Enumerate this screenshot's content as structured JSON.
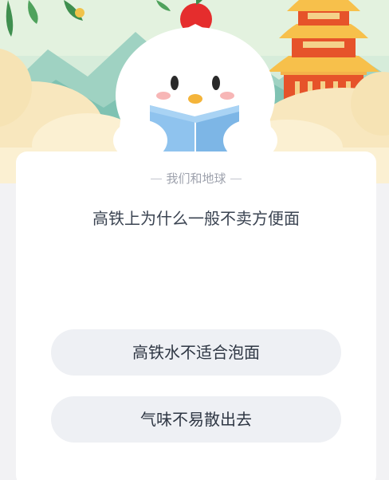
{
  "quiz": {
    "category": "我们和地球",
    "question": "高铁上为什么一般不卖方便面",
    "options": [
      {
        "label": "高铁水不适合泡面"
      },
      {
        "label": "气味不易散出去"
      }
    ]
  },
  "colors": {
    "page_background": "#f2f2f4",
    "card": "#ffffff",
    "option_background": "#eef0f4",
    "question_text": "#3b4452",
    "category_text": "#9ea2ad",
    "sky": "#d6ecda",
    "mountains": "#7fc2b2",
    "clouds": "#f8e7be",
    "tower": "#e6532a",
    "mascot_book": "#8fc3ee",
    "mascot_comb": "#e52d2d"
  },
  "icons": {
    "mascot": "chick-mascot-reading-illustration",
    "tower": "yellow-crane-tower-icon",
    "leaves": "leaf-branch-icon",
    "dashes": "divider-dash-icon"
  }
}
